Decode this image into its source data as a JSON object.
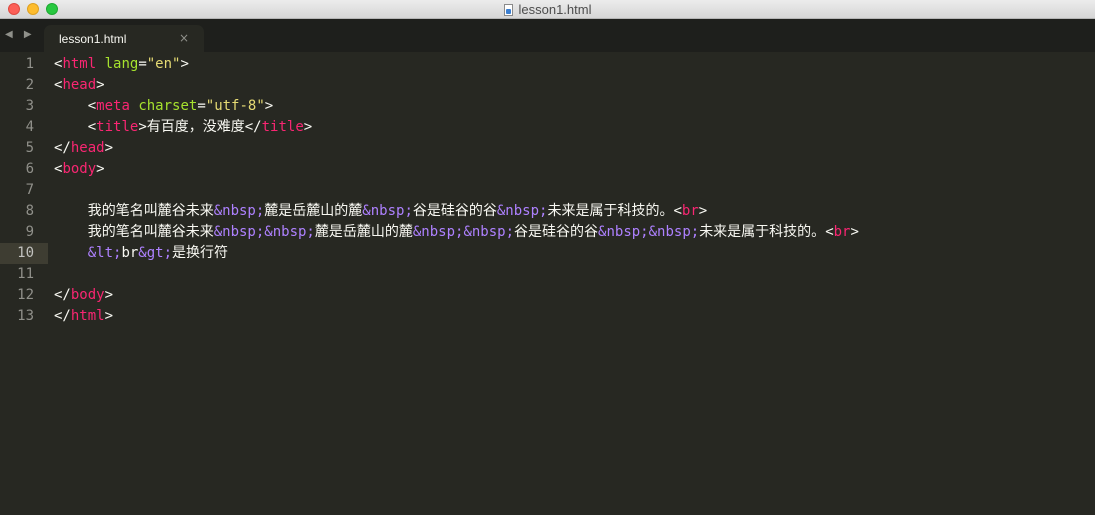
{
  "window": {
    "title": "lesson1.html"
  },
  "tabs": [
    {
      "label": "lesson1.html",
      "close": "×"
    }
  ],
  "nav": {
    "arrows": "◀ ▶"
  },
  "editor": {
    "current_line": 10,
    "lines": [
      {
        "num": "1",
        "tokens": [
          [
            "p",
            "<"
          ],
          [
            "t",
            "html"
          ],
          [
            "x",
            " "
          ],
          [
            "a",
            "lang"
          ],
          [
            "p",
            "="
          ],
          [
            "s",
            "\"en\""
          ],
          [
            "p",
            ">"
          ]
        ]
      },
      {
        "num": "2",
        "tokens": [
          [
            "p",
            "<"
          ],
          [
            "t",
            "head"
          ],
          [
            "p",
            ">"
          ]
        ]
      },
      {
        "num": "3",
        "tokens": [
          [
            "x",
            "    "
          ],
          [
            "p",
            "<"
          ],
          [
            "t",
            "meta"
          ],
          [
            "x",
            " "
          ],
          [
            "a",
            "charset"
          ],
          [
            "p",
            "="
          ],
          [
            "s",
            "\"utf-8\""
          ],
          [
            "p",
            ">"
          ]
        ]
      },
      {
        "num": "4",
        "tokens": [
          [
            "x",
            "    "
          ],
          [
            "p",
            "<"
          ],
          [
            "t",
            "title"
          ],
          [
            "p",
            ">"
          ],
          [
            "x",
            "有百度，没难度"
          ],
          [
            "p",
            "</"
          ],
          [
            "t",
            "title"
          ],
          [
            "p",
            ">"
          ]
        ]
      },
      {
        "num": "5",
        "tokens": [
          [
            "p",
            "</"
          ],
          [
            "t",
            "head"
          ],
          [
            "p",
            ">"
          ]
        ]
      },
      {
        "num": "6",
        "tokens": [
          [
            "p",
            "<"
          ],
          [
            "t",
            "body"
          ],
          [
            "p",
            ">"
          ]
        ]
      },
      {
        "num": "7",
        "tokens": []
      },
      {
        "num": "8",
        "tokens": [
          [
            "x",
            "    我的笔名叫麓谷未来"
          ],
          [
            "e",
            "&nbsp;"
          ],
          [
            "x",
            "麓是岳麓山的麓"
          ],
          [
            "e",
            "&nbsp;"
          ],
          [
            "x",
            "谷是硅谷的谷"
          ],
          [
            "e",
            "&nbsp;"
          ],
          [
            "x",
            "未来是属于科技的。"
          ],
          [
            "p",
            "<"
          ],
          [
            "t",
            "br"
          ],
          [
            "p",
            ">"
          ]
        ]
      },
      {
        "num": "9",
        "tokens": [
          [
            "x",
            "    我的笔名叫麓谷未来"
          ],
          [
            "e",
            "&nbsp;&nbsp;"
          ],
          [
            "x",
            "麓是岳麓山的麓"
          ],
          [
            "e",
            "&nbsp;&nbsp;"
          ],
          [
            "x",
            "谷是硅谷的谷"
          ],
          [
            "e",
            "&nbsp;&nbsp;"
          ],
          [
            "x",
            "未来是属于科技的。"
          ],
          [
            "p",
            "<"
          ],
          [
            "t",
            "br"
          ],
          [
            "p",
            ">"
          ]
        ]
      },
      {
        "num": "10",
        "tokens": [
          [
            "x",
            "    "
          ],
          [
            "e",
            "&lt;"
          ],
          [
            "x",
            "br"
          ],
          [
            "e",
            "&gt;"
          ],
          [
            "x",
            "是换行符"
          ]
        ]
      },
      {
        "num": "11",
        "tokens": []
      },
      {
        "num": "12",
        "tokens": [
          [
            "p",
            "</"
          ],
          [
            "t",
            "body"
          ],
          [
            "p",
            ">"
          ]
        ]
      },
      {
        "num": "13",
        "tokens": [
          [
            "p",
            "</"
          ],
          [
            "t",
            "html"
          ],
          [
            "p",
            ">"
          ]
        ]
      }
    ]
  }
}
